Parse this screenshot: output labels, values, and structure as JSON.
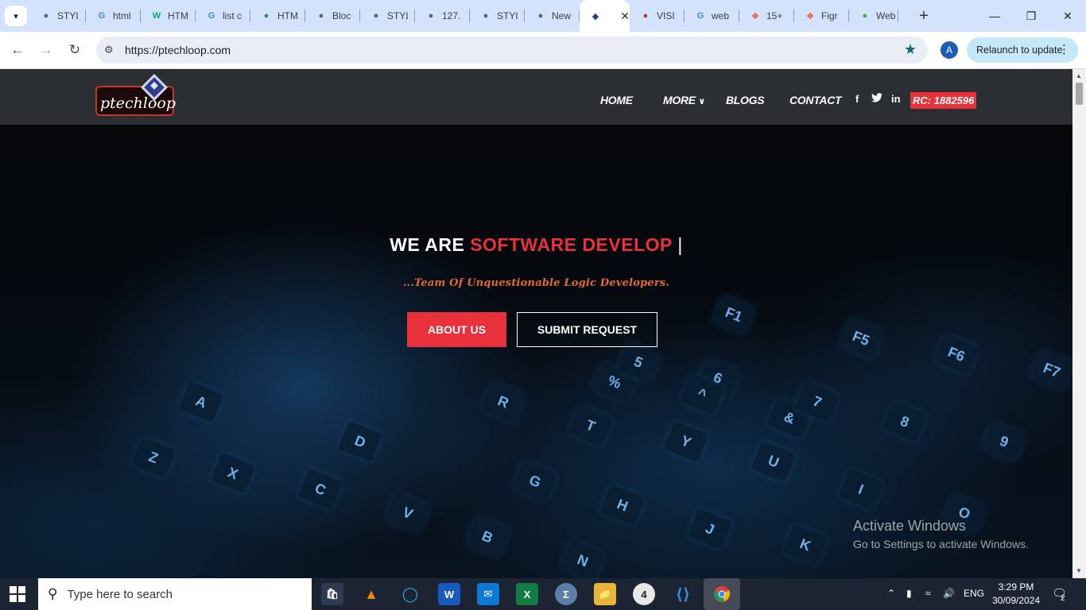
{
  "browser": {
    "tabs": [
      {
        "title": "STYL",
        "icon": "globe-icon",
        "color": "#5f6368"
      },
      {
        "title": "html",
        "icon": "google-icon",
        "color": "#4285f4"
      },
      {
        "title": "HTM",
        "icon": "w3schools-icon",
        "color": "#04aa6d"
      },
      {
        "title": "list c",
        "icon": "google-icon",
        "color": "#4285f4"
      },
      {
        "title": "HTM",
        "icon": "geeks-icon",
        "color": "#2f8d46"
      },
      {
        "title": "Bloc",
        "icon": "circle-logo-icon",
        "color": "#5f6368"
      },
      {
        "title": "STYL",
        "icon": "globe-icon",
        "color": "#5f6368"
      },
      {
        "title": "127.",
        "icon": "globe-icon",
        "color": "#5f6368"
      },
      {
        "title": "STYL",
        "icon": "globe-icon",
        "color": "#5f6368"
      },
      {
        "title": "New",
        "icon": "chrome-icon",
        "color": "#5f6368"
      },
      {
        "title": "",
        "icon": "ptechloop-favicon-icon",
        "color": "#2d3d8a",
        "active": true
      },
      {
        "title": "VISI",
        "icon": "visi-icon",
        "color": "#c0392b"
      },
      {
        "title": "web",
        "icon": "google-icon",
        "color": "#4285f4"
      },
      {
        "title": "15+",
        "icon": "figma-icon",
        "color": "#f24e1e"
      },
      {
        "title": "Figr",
        "icon": "figma-icon",
        "color": "#f24e1e"
      },
      {
        "title": "Web",
        "icon": "green-app-icon",
        "color": "#3cb043"
      }
    ],
    "url": "https://ptechloop.com",
    "profile_initial": "A",
    "relaunch_label": "Relaunch to update"
  },
  "site": {
    "logo_text": "ptechloop",
    "nav": {
      "home": "HOME",
      "more": "MORE",
      "blogs": "BLOGS",
      "contact": "CONTACT"
    },
    "social": {
      "facebook": "f",
      "twitter": "twitter",
      "linkedin": "in"
    },
    "rc_badge": "RC: 1882596",
    "hero": {
      "headline_white": "WE ARE",
      "headline_red": "SOFTWARE DEVELOP",
      "cursor": "|",
      "tagline": "...Team Of Unquestionable Logic Developers.",
      "about_button": "ABOUT US",
      "submit_button": "SUBMIT REQUEST"
    },
    "keys": [
      "F1",
      "F5",
      "F6",
      "F7",
      "6",
      "%",
      "5",
      "R",
      "T",
      "Y",
      "U",
      "I",
      "O",
      "8",
      "9",
      "&",
      "7",
      "^",
      "A",
      "Z",
      "X",
      "C",
      "V",
      "D",
      "G",
      "H",
      "J",
      "K",
      "B",
      "N"
    ]
  },
  "watermark": {
    "line1": "Activate Windows",
    "line2": "Go to Settings to activate Windows."
  },
  "taskbar": {
    "search_placeholder": "Type here to search",
    "language": "ENG",
    "time": "3:29 PM",
    "date": "30/09/2024",
    "notification_count": "2",
    "whatsapp_badge": "4"
  },
  "colors": {
    "accent_red": "#e8313a",
    "nav_bg": "#2b2e33",
    "tagline_orange": "#e26a2c"
  }
}
